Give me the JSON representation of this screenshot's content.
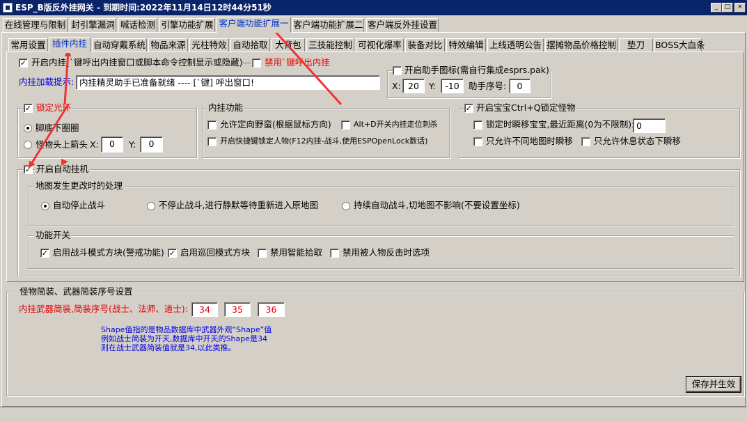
{
  "window": {
    "title": "ESP_B版反外挂网关 - 到期时间:2022年11月14日12时44分51秒"
  },
  "main_tabs": [
    {
      "label": "在线管理与限制"
    },
    {
      "label": "封引擎漏洞"
    },
    {
      "label": "喊话检测"
    },
    {
      "label": "引擎功能扩展"
    },
    {
      "label": "客户端功能扩展一"
    },
    {
      "label": "客户端功能扩展二"
    },
    {
      "label": "客户端反外挂设置"
    }
  ],
  "sub_tabs": [
    {
      "label": "常用设置"
    },
    {
      "label": "插件内挂"
    },
    {
      "label": "自动穿戴系统"
    },
    {
      "label": "物品来源"
    },
    {
      "label": "光柱特效"
    },
    {
      "label": "自动拾取"
    },
    {
      "label": "大背包"
    },
    {
      "label": "三技能控制"
    },
    {
      "label": "可视化爆率"
    },
    {
      "label": "装备对比"
    },
    {
      "label": "特效编辑"
    },
    {
      "label": "上线透明公告"
    },
    {
      "label": "摆摊物品价格控制"
    },
    {
      "label": "垫刀"
    },
    {
      "label": "BOSS大血条"
    }
  ],
  "plugin": {
    "enable_label": "开启内挂(`键呼出内挂窗口或脚本命令控制显示或隐藏)",
    "enable_checked": true,
    "disable_key_label": "禁用`键呼出内挂",
    "disable_key_checked": false,
    "load_hint_label": "内挂加载提示:",
    "load_hint_value": "内挂精灵助手已准备就绪 ---- [`键] 呼出窗口!"
  },
  "helper_icon": {
    "label": "开启助手图标(需自行集成esprs.pak)",
    "checked": false,
    "x_label": "X:",
    "x_value": "20",
    "y_label": "Y:",
    "y_value": "-10",
    "index_label": "助手序号:",
    "index_value": "0"
  },
  "lock_ring": {
    "title": "锁定光环",
    "checked": true,
    "option1": "脚底下圈圈",
    "option2": "怪物头上箭头",
    "x_label": "X:",
    "x_value": "0",
    "y_label": "Y:",
    "y_value": "0"
  },
  "plugin_functions": {
    "title": "内挂功能",
    "opt1": "允许定向野蛮(根据鼠标方向)",
    "opt2": "Alt+D开关内挂走位刺杀",
    "opt3": "开启快捷键锁定人物(F12内挂-战斗,使用ESPOpenLock数话)"
  },
  "baby": {
    "title": "开启宝宝Ctrl+Q锁定怪物",
    "checked": true,
    "teleport_label": "锁定时瞬移宝宝,最近距离(0为不限制):",
    "teleport_value": "0",
    "diff_map_label": "只允许不同地图时瞬移",
    "rest_label": "只允许休息状态下瞬移"
  },
  "auto_hang": {
    "title": "开启自动挂机",
    "checked": true,
    "map_change": {
      "title": "地图发生更改时的处理",
      "opt1": "自动停止战斗",
      "opt2": "不停止战斗,进行静默等待重新进入原地图",
      "opt3": "持续自动战斗,切地图不影响(不要设置坐标)"
    },
    "switches": {
      "title": "功能开关",
      "opt1": "启用战斗模式方块(警戒功能)",
      "opt1_checked": true,
      "opt2": "启用巡回模式方块",
      "opt2_checked": true,
      "opt3": "禁用智能拾取",
      "opt3_checked": false,
      "opt4": "禁用被人物反击时选项",
      "opt4_checked": false
    }
  },
  "weapon_shape": {
    "title": "怪物简装、武器简装序号设置",
    "label": "内挂武器简装,简装序号(战士、法师、道士):",
    "warrior": "34",
    "mage": "35",
    "taoist": "36",
    "note_line1": "Shape值指的是物品数据库中武器外观“Shape”值",
    "note_line2": "例如战士简装为开天,数据库中开天的Shape是34",
    "note_line3": "则在战士武器简装值就是34,以此类推。"
  },
  "save_button": "保存并生效",
  "accent_colors": {
    "title_bar": "#0a246a",
    "annotation_red": "#ee3333",
    "label_red": "#e00000",
    "label_blue": "#0000e0"
  }
}
